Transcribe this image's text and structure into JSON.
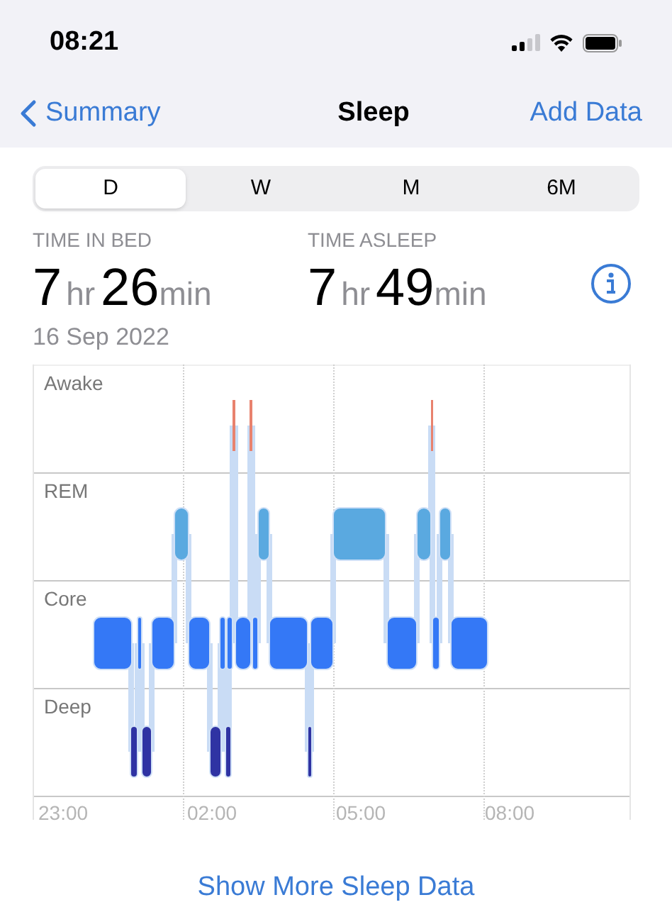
{
  "status_bar": {
    "time": "08:21"
  },
  "nav": {
    "back": "Summary",
    "title": "Sleep",
    "action": "Add Data"
  },
  "segments": [
    {
      "label": "D",
      "selected": true
    },
    {
      "label": "W",
      "selected": false
    },
    {
      "label": "M",
      "selected": false
    },
    {
      "label": "6M",
      "selected": false
    }
  ],
  "stats": [
    {
      "label": "TIME IN BED",
      "hours": "7",
      "hours_unit": "hr",
      "minutes": "26",
      "minutes_unit": "min"
    },
    {
      "label": "TIME ASLEEP",
      "hours": "7",
      "hours_unit": "hr",
      "minutes": "49",
      "minutes_unit": "min"
    }
  ],
  "date": "16 Sep 2022",
  "chart": {
    "stages": [
      "Awake",
      "REM",
      "Core",
      "Deep"
    ],
    "times": [
      "23:00",
      "02:00",
      "05:00",
      "08:00"
    ]
  },
  "footer_link": "Show More Sleep Data"
}
